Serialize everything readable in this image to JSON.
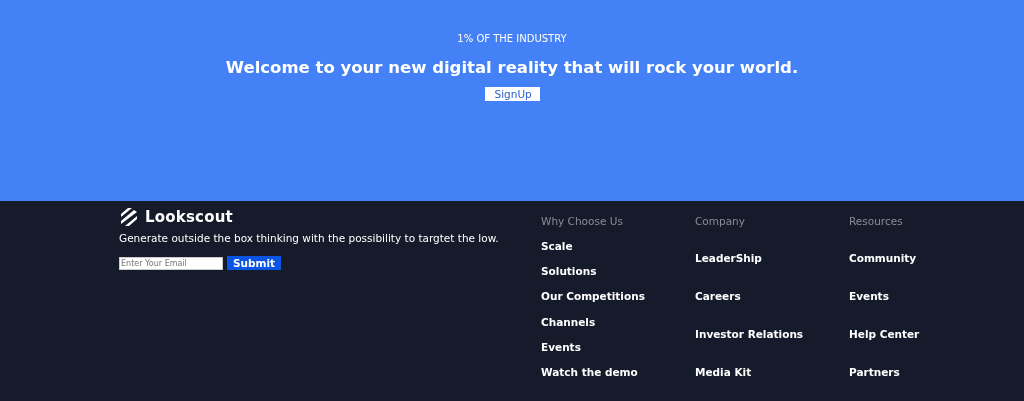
{
  "hero": {
    "eyebrow": "1% OF THE INDUSTRY",
    "headline": "Welcome to your new digital reality that will rock your world.",
    "button": "SignUp"
  },
  "footer": {
    "brand": "Lookscout",
    "tagline": "Generate outside the box thinking with the possibility to targtet the low.",
    "email": {
      "placeholder": "Enter Your Email"
    },
    "submit": "Submit",
    "columns": [
      {
        "title": "Why Choose Us",
        "links": [
          "Scale",
          "Solutions",
          "Our Competitions",
          "Channels",
          "Events",
          "Watch the demo"
        ]
      },
      {
        "title": "Company",
        "links": [
          "LeaderShip",
          "Careers",
          "Investor Relations",
          "Media Kit"
        ]
      },
      {
        "title": "Resources",
        "links": [
          "Community",
          "Events",
          "Help Center",
          "Partners"
        ]
      }
    ]
  }
}
